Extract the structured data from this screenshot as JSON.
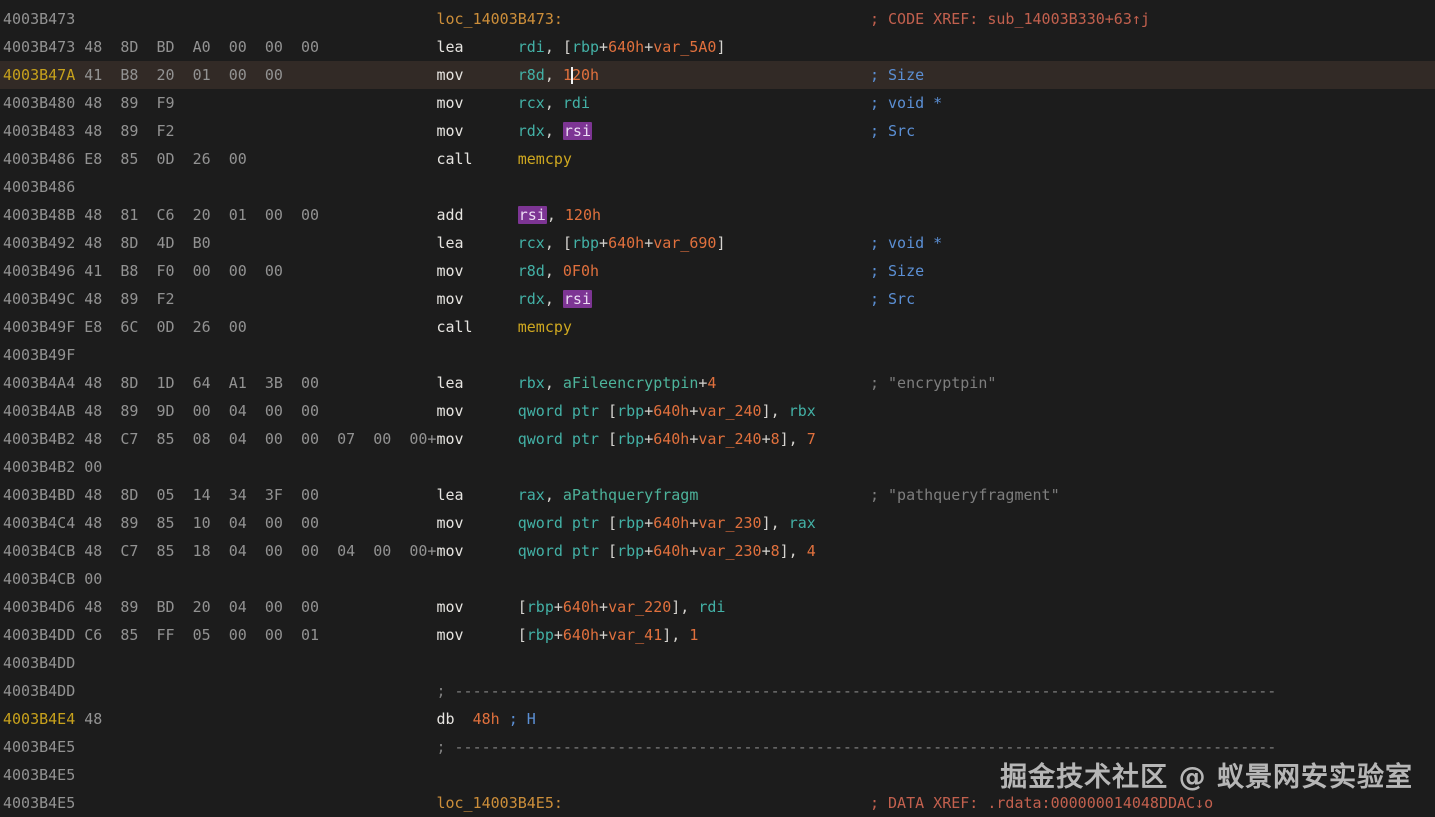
{
  "watermark": "掘金技术社区 @ 蚁景网安实验室",
  "colors": {
    "background": "#1c1c1c",
    "current_line_bg": "#322a26",
    "address": "#929292",
    "address_highlight": "#c7a11c",
    "mnemonic": "#e6e4e0",
    "register": "#43b1a6",
    "number": "#e0703d",
    "code_label": "#cc8e3a",
    "function_name": "#cfa820",
    "data_name": "#4db39b",
    "comment_blue": "#5b8fd4",
    "comment_xref": "#c2604e",
    "comment_gray": "#7e7e7e",
    "register_highlight_bg": "#7d3594"
  },
  "listing": {
    "lines": [
      {
        "a": "4003B473",
        "code": [
          [
            "loc_14003B473:",
            "l"
          ]
        ],
        "cmt": [
          [
            "; CODE XREF: sub_14003B330+63↑j",
            "cx"
          ]
        ]
      },
      {
        "a": "4003B473",
        "b": "48  8D  BD  A0  00  00  00",
        "code": [
          [
            "lea",
            "m"
          ],
          [
            "      ",
            "p"
          ],
          [
            "rdi",
            "r"
          ],
          [
            ", [",
            "p"
          ],
          [
            "rbp",
            "r"
          ],
          [
            "+",
            "p"
          ],
          [
            "640h",
            "n"
          ],
          [
            "+",
            "p"
          ],
          [
            "var_5A0",
            "n"
          ],
          [
            "]",
            "p"
          ]
        ]
      },
      {
        "a": "4003B47A",
        "ac": "ah",
        "hl": true,
        "b": "41  B8  20  01  00  00",
        "code": [
          [
            "mov",
            "m"
          ],
          [
            "      ",
            "p"
          ],
          [
            "r8d",
            "r"
          ],
          [
            ", ",
            "p"
          ],
          [
            "1",
            "n"
          ],
          [
            "",
            "cr"
          ],
          [
            "20h",
            "n"
          ]
        ],
        "cmt": [
          [
            "; Size",
            "cb"
          ]
        ]
      },
      {
        "a": "4003B480",
        "b": "48  89  F9",
        "code": [
          [
            "mov",
            "m"
          ],
          [
            "      ",
            "p"
          ],
          [
            "rcx",
            "r"
          ],
          [
            ", ",
            "p"
          ],
          [
            "rdi",
            "r"
          ]
        ],
        "cmt": [
          [
            "; void *",
            "cb"
          ]
        ]
      },
      {
        "a": "4003B483",
        "b": "48  89  F2",
        "code": [
          [
            "mov",
            "m"
          ],
          [
            "      ",
            "p"
          ],
          [
            "rdx",
            "r"
          ],
          [
            ", ",
            "p"
          ],
          [
            "rsi",
            "hlr"
          ]
        ],
        "cmt": [
          [
            "; Src",
            "cb"
          ]
        ]
      },
      {
        "a": "4003B486",
        "b": "E8  85  0D  26  00",
        "code": [
          [
            "call",
            "m"
          ],
          [
            "     ",
            "p"
          ],
          [
            "memcpy",
            "f"
          ]
        ]
      },
      {
        "a": "4003B486"
      },
      {
        "a": "4003B48B",
        "b": "48  81  C6  20  01  00  00",
        "code": [
          [
            "add",
            "m"
          ],
          [
            "      ",
            "p"
          ],
          [
            "rsi",
            "hlr"
          ],
          [
            ", ",
            "p"
          ],
          [
            "120h",
            "n"
          ]
        ]
      },
      {
        "a": "4003B492",
        "b": "48  8D  4D  B0",
        "code": [
          [
            "lea",
            "m"
          ],
          [
            "      ",
            "p"
          ],
          [
            "rcx",
            "r"
          ],
          [
            ", [",
            "p"
          ],
          [
            "rbp",
            "r"
          ],
          [
            "+",
            "p"
          ],
          [
            "640h",
            "n"
          ],
          [
            "+",
            "p"
          ],
          [
            "var_690",
            "n"
          ],
          [
            "]",
            "p"
          ]
        ],
        "cmt": [
          [
            "; void *",
            "cb"
          ]
        ]
      },
      {
        "a": "4003B496",
        "b": "41  B8  F0  00  00  00",
        "code": [
          [
            "mov",
            "m"
          ],
          [
            "      ",
            "p"
          ],
          [
            "r8d",
            "r"
          ],
          [
            ", ",
            "p"
          ],
          [
            "0F0h",
            "n"
          ]
        ],
        "cmt": [
          [
            "; Size",
            "cb"
          ]
        ]
      },
      {
        "a": "4003B49C",
        "b": "48  89  F2",
        "code": [
          [
            "mov",
            "m"
          ],
          [
            "      ",
            "p"
          ],
          [
            "rdx",
            "r"
          ],
          [
            ", ",
            "p"
          ],
          [
            "rsi",
            "hlr"
          ]
        ],
        "cmt": [
          [
            "; Src",
            "cb"
          ]
        ]
      },
      {
        "a": "4003B49F",
        "b": "E8  6C  0D  26  00",
        "code": [
          [
            "call",
            "m"
          ],
          [
            "     ",
            "p"
          ],
          [
            "memcpy",
            "f"
          ]
        ]
      },
      {
        "a": "4003B49F"
      },
      {
        "a": "4003B4A4",
        "b": "48  8D  1D  64  A1  3B  00",
        "code": [
          [
            "lea",
            "m"
          ],
          [
            "      ",
            "p"
          ],
          [
            "rbx",
            "r"
          ],
          [
            ", ",
            "p"
          ],
          [
            "aFileencryptpin",
            "d"
          ],
          [
            "+",
            "p"
          ],
          [
            "4",
            "n"
          ]
        ],
        "cmt": [
          [
            "; \"encryptpin\"",
            "cg"
          ]
        ]
      },
      {
        "a": "4003B4AB",
        "b": "48  89  9D  00  04  00  00",
        "code": [
          [
            "mov",
            "m"
          ],
          [
            "      ",
            "p"
          ],
          [
            "qword ptr",
            "r"
          ],
          [
            " [",
            "p"
          ],
          [
            "rbp",
            "r"
          ],
          [
            "+",
            "p"
          ],
          [
            "640h",
            "n"
          ],
          [
            "+",
            "p"
          ],
          [
            "var_240",
            "n"
          ],
          [
            "], ",
            "p"
          ],
          [
            "rbx",
            "r"
          ]
        ]
      },
      {
        "a": "4003B4B2",
        "b": "48  C7  85  08  04  00  00  07  00  00+",
        "code": [
          [
            "mov",
            "m"
          ],
          [
            "      ",
            "p"
          ],
          [
            "qword ptr",
            "r"
          ],
          [
            " [",
            "p"
          ],
          [
            "rbp",
            "r"
          ],
          [
            "+",
            "p"
          ],
          [
            "640h",
            "n"
          ],
          [
            "+",
            "p"
          ],
          [
            "var_240",
            "n"
          ],
          [
            "+",
            "p"
          ],
          [
            "8",
            "n"
          ],
          [
            "], ",
            "p"
          ],
          [
            "7",
            "n"
          ]
        ]
      },
      {
        "a": "4003B4B2",
        "b": "00"
      },
      {
        "a": "4003B4BD",
        "b": "48  8D  05  14  34  3F  00",
        "code": [
          [
            "lea",
            "m"
          ],
          [
            "      ",
            "p"
          ],
          [
            "rax",
            "r"
          ],
          [
            ", ",
            "p"
          ],
          [
            "aPathqueryfragm",
            "d"
          ]
        ],
        "cmt": [
          [
            "; \"pathqueryfragment\"",
            "cg"
          ]
        ]
      },
      {
        "a": "4003B4C4",
        "b": "48  89  85  10  04  00  00",
        "code": [
          [
            "mov",
            "m"
          ],
          [
            "      ",
            "p"
          ],
          [
            "qword ptr",
            "r"
          ],
          [
            " [",
            "p"
          ],
          [
            "rbp",
            "r"
          ],
          [
            "+",
            "p"
          ],
          [
            "640h",
            "n"
          ],
          [
            "+",
            "p"
          ],
          [
            "var_230",
            "n"
          ],
          [
            "], ",
            "p"
          ],
          [
            "rax",
            "r"
          ]
        ]
      },
      {
        "a": "4003B4CB",
        "b": "48  C7  85  18  04  00  00  04  00  00+",
        "code": [
          [
            "mov",
            "m"
          ],
          [
            "      ",
            "p"
          ],
          [
            "qword ptr",
            "r"
          ],
          [
            " [",
            "p"
          ],
          [
            "rbp",
            "r"
          ],
          [
            "+",
            "p"
          ],
          [
            "640h",
            "n"
          ],
          [
            "+",
            "p"
          ],
          [
            "var_230",
            "n"
          ],
          [
            "+",
            "p"
          ],
          [
            "8",
            "n"
          ],
          [
            "], ",
            "p"
          ],
          [
            "4",
            "n"
          ]
        ]
      },
      {
        "a": "4003B4CB",
        "b": "00"
      },
      {
        "a": "4003B4D6",
        "b": "48  89  BD  20  04  00  00",
        "code": [
          [
            "mov",
            "m"
          ],
          [
            "      ",
            "p"
          ],
          [
            "[",
            "p"
          ],
          [
            "rbp",
            "r"
          ],
          [
            "+",
            "p"
          ],
          [
            "640h",
            "n"
          ],
          [
            "+",
            "p"
          ],
          [
            "var_220",
            "n"
          ],
          [
            "], ",
            "p"
          ],
          [
            "rdi",
            "r"
          ]
        ]
      },
      {
        "a": "4003B4DD",
        "b": "C6  85  FF  05  00  00  01",
        "code": [
          [
            "mov",
            "m"
          ],
          [
            "      ",
            "p"
          ],
          [
            "[",
            "p"
          ],
          [
            "rbp",
            "r"
          ],
          [
            "+",
            "p"
          ],
          [
            "640h",
            "n"
          ],
          [
            "+",
            "p"
          ],
          [
            "var_41",
            "n"
          ],
          [
            "], ",
            "p"
          ],
          [
            "1",
            "n"
          ]
        ]
      },
      {
        "a": "4003B4DD"
      },
      {
        "a": "4003B4DD",
        "code": [
          [
            "; -------------------------------------------------------------------------------------------",
            "cg"
          ]
        ]
      },
      {
        "a": "4003B4E4",
        "ac": "ah",
        "b": "48",
        "code": [
          [
            "db",
            "m"
          ],
          [
            "  ",
            "p"
          ],
          [
            "48h",
            "n"
          ],
          [
            " ",
            "p"
          ],
          [
            "; H",
            "cb"
          ]
        ]
      },
      {
        "a": "4003B4E5",
        "code": [
          [
            "; -------------------------------------------------------------------------------------------",
            "cg"
          ]
        ]
      },
      {
        "a": "4003B4E5"
      },
      {
        "a": "4003B4E5",
        "code": [
          [
            "loc_14003B4E5:",
            "l"
          ]
        ],
        "cmt": [
          [
            "; DATA XREF: .rdata:000000014048DDAC↓o",
            "cx"
          ]
        ]
      }
    ]
  }
}
